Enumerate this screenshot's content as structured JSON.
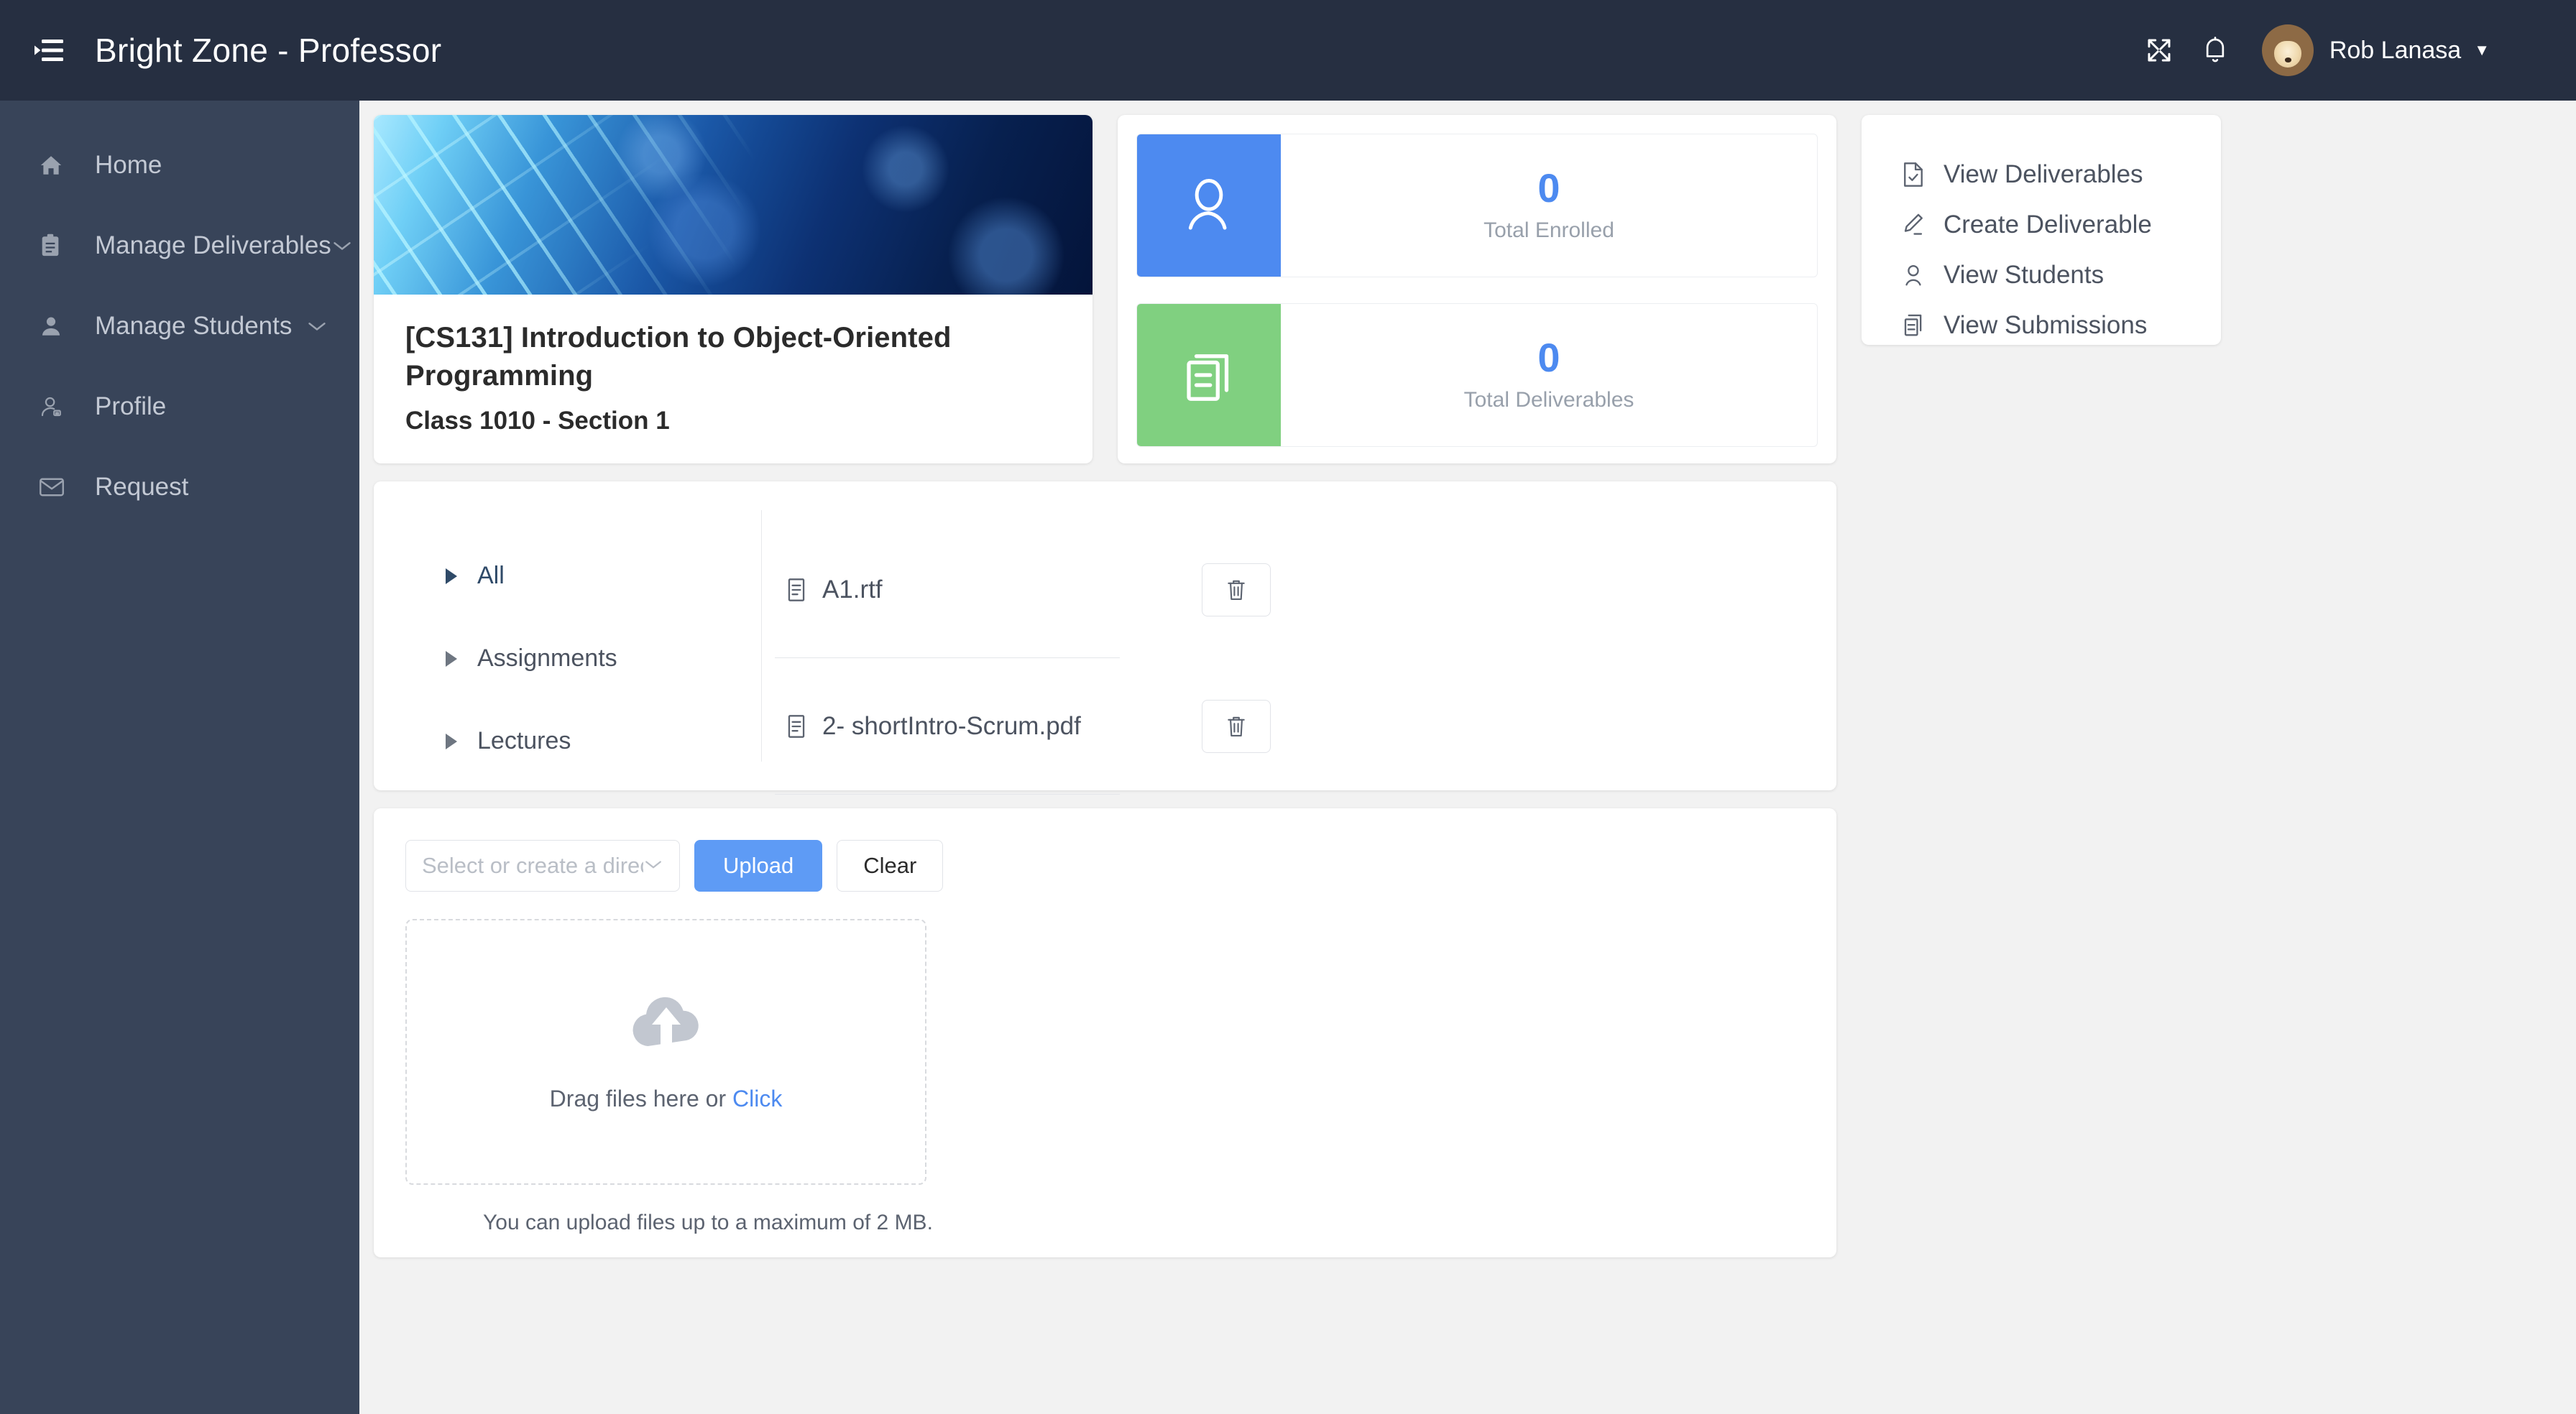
{
  "header": {
    "title": "Bright Zone - Professor",
    "menu_icon": "hamburger-menu-icon",
    "fullscreen_icon": "expand-fullscreen-icon",
    "notifications_icon": "bell-icon",
    "avatar_icon": "user-avatar-photo",
    "username": "Rob Lanasa",
    "caret": "▼"
  },
  "sidebar": {
    "items": [
      {
        "label": "Home",
        "icon": "home-icon",
        "expandable": false
      },
      {
        "label": "Manage Deliverables",
        "icon": "clipboard-icon",
        "expandable": true
      },
      {
        "label": "Manage Students",
        "icon": "person-icon",
        "expandable": true
      },
      {
        "label": "Profile",
        "icon": "profile-badge-icon",
        "expandable": false
      },
      {
        "label": "Request",
        "icon": "envelope-icon",
        "expandable": false
      }
    ]
  },
  "course": {
    "banner_alt": "circuit-board-banner-image",
    "title": "[CS131] Introduction to Object-Oriented Programming",
    "subtitle": "Class 1010 - Section 1"
  },
  "stats": [
    {
      "value": "0",
      "label": "Total Enrolled",
      "icon": "person-outline-icon",
      "color": "#4d8af0"
    },
    {
      "value": "0",
      "label": "Total Deliverables",
      "icon": "documents-stack-icon",
      "color": "#80d080"
    }
  ],
  "quick_actions": [
    {
      "label": "View Deliverables",
      "icon": "document-check-icon"
    },
    {
      "label": "Create Deliverable",
      "icon": "pencil-icon"
    },
    {
      "label": "View Students",
      "icon": "person-outline-icon"
    },
    {
      "label": "View Submissions",
      "icon": "copy-documents-icon"
    }
  ],
  "file_browser": {
    "tree": [
      {
        "label": "All",
        "selected": true
      },
      {
        "label": "Assignments",
        "selected": false
      },
      {
        "label": "Lectures",
        "selected": false
      }
    ],
    "files": [
      {
        "name": "A1.rtf",
        "icon": "file-document-icon",
        "delete_icon": "trash-icon"
      },
      {
        "name": "2- shortIntro-Scrum.pdf",
        "icon": "file-document-icon",
        "delete_icon": "trash-icon"
      }
    ]
  },
  "upload": {
    "directory_placeholder": "Select or create a directo",
    "directory_caret_icon": "chevron-down-icon",
    "upload_label": "Upload",
    "clear_label": "Clear",
    "dropzone_icon": "cloud-upload-icon",
    "dropzone_text": "Drag files here or ",
    "dropzone_link": "Click",
    "hint": "You can upload files up to a maximum of 2 MB."
  },
  "colors": {
    "header_bg": "#262f41",
    "sidebar_bg": "#384459",
    "page_bg": "#f2f2f2",
    "accent_blue": "#4d8af0",
    "accent_green": "#80d080",
    "tree_selected": "#2f4a68"
  }
}
